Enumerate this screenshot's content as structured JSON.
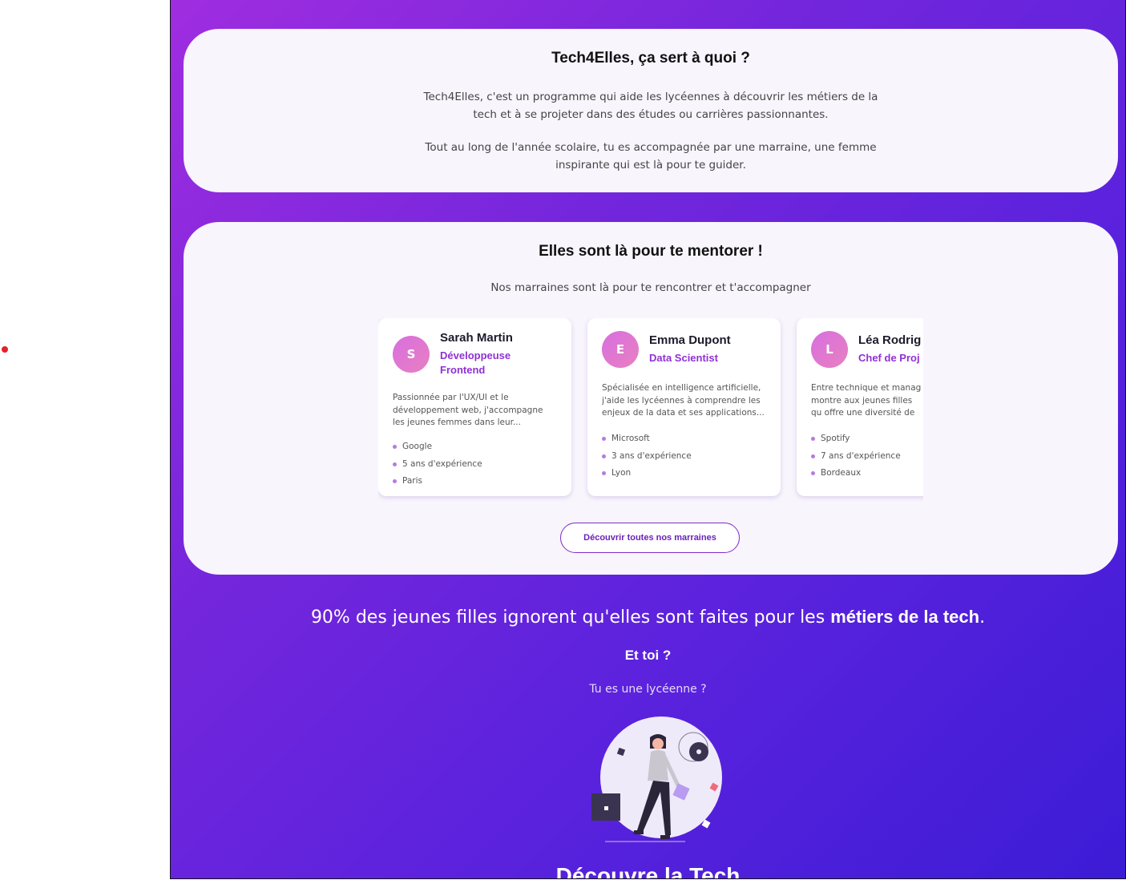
{
  "about": {
    "title": "Tech4Elles, ça sert à quoi ?",
    "paragraph1": "Tech4Elles, c'est un programme qui aide les lycéennes à découvrir les métiers de la tech et à se projeter dans des études ou carrières passionnantes.",
    "paragraph2": "Tout au long de l'année scolaire, tu es accompagnée par une marraine, une femme inspirante qui est là pour te guider."
  },
  "mentors": {
    "title": "Elles sont là pour te mentorer !",
    "subtitle": "Nos marraines sont là pour te rencontrer et t'accompagner",
    "cards": [
      {
        "initial": "S",
        "name": "Sarah Martin",
        "role": "Développeuse Frontend",
        "description": "Passionnée par l'UX/UI et le développement web, j'accompagne les jeunes femmes dans leur...",
        "company": "Google",
        "experience": "5 ans d'expérience",
        "city": "Paris"
      },
      {
        "initial": "E",
        "name": "Emma Dupont",
        "role": "Data Scientist",
        "description": "Spécialisée en intelligence artificielle, j'aide les lycéennes à comprendre les enjeux de la data et ses applications...",
        "company": "Microsoft",
        "experience": "3 ans d'expérience",
        "city": "Lyon"
      },
      {
        "initial": "L",
        "name": "Léa Rodrig",
        "role": "Chef de Proj",
        "description": "Entre technique et manag montre aux jeunes filles qu offre une diversité de méti",
        "company": "Spotify",
        "experience": "7 ans d'expérience",
        "city": "Bordeaux"
      }
    ],
    "cta": "Découvrir toutes nos marraines"
  },
  "stat": {
    "prefix": "90% des jeunes filles ignorent qu'elles sont faites pour les ",
    "highlight": "métiers de la tech",
    "suffix": "."
  },
  "question": "Et toi ?",
  "lyceenne": "Tu es une lycéenne ?",
  "bottom_title": "Découvre la Tech",
  "colors": {
    "accent": "#9031d4",
    "gradient_start": "#a02de0",
    "gradient_end": "#3c1cd6",
    "card_bg": "#f8f5fd"
  }
}
